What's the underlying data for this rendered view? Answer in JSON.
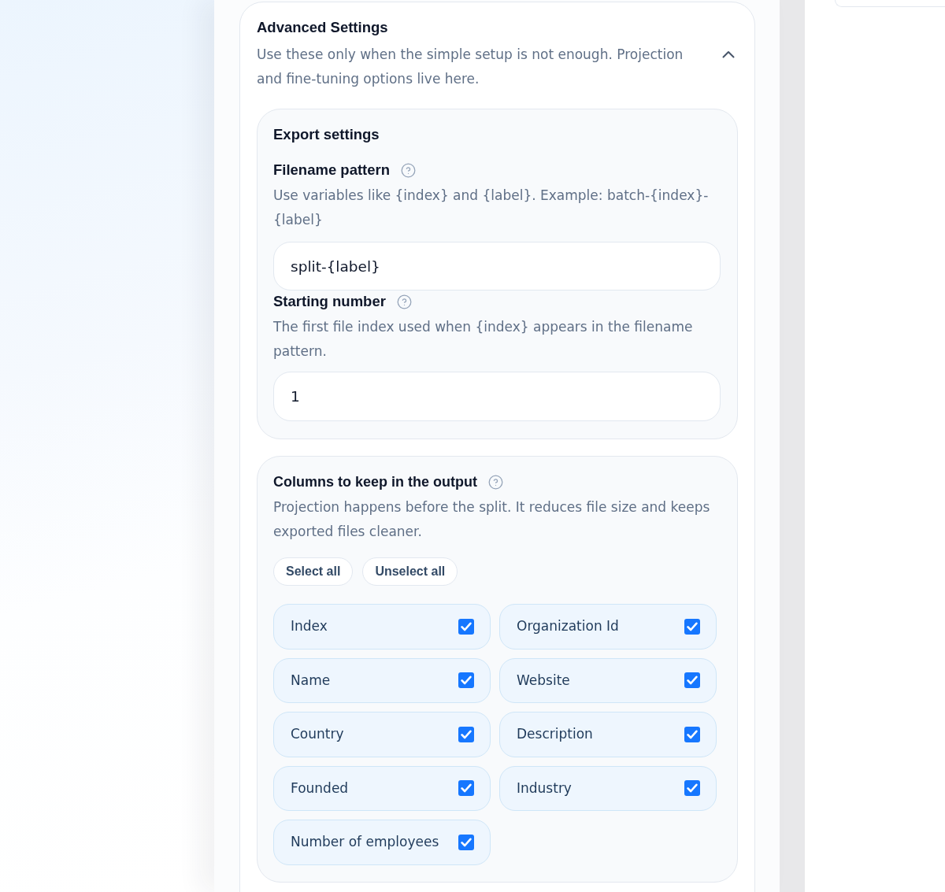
{
  "section": {
    "title": "Advanced Settings",
    "description": "Use these only when the simple setup is not enough. Projection and fine-tuning options live here.",
    "expanded": true
  },
  "export_settings": {
    "title": "Export settings",
    "fields": [
      {
        "label": "Filename pattern",
        "description": "Use variables like {index} and {label}. Example: batch-{index}-{label}",
        "input": {
          "value": "split-{label}"
        }
      },
      {
        "label": "Starting number",
        "description": "The first file index used when {index} appears in the filename pattern.",
        "input": {
          "value": "1"
        }
      }
    ]
  },
  "columns": {
    "title": "Columns to keep in the output",
    "description": "Projection happens before the split. It reduces file size and keeps exported files cleaner.",
    "buttons": [
      "Select all",
      "Unselect all"
    ],
    "items": [
      {
        "label": "Index",
        "checked": true
      },
      {
        "label": "Organization Id",
        "checked": true
      },
      {
        "label": "Name",
        "checked": true
      },
      {
        "label": "Website",
        "checked": true
      },
      {
        "label": "Country",
        "checked": true
      },
      {
        "label": "Description",
        "checked": true
      },
      {
        "label": "Founded",
        "checked": true
      },
      {
        "label": "Industry",
        "checked": true
      },
      {
        "label": "Number of employees",
        "checked": true
      }
    ]
  }
}
